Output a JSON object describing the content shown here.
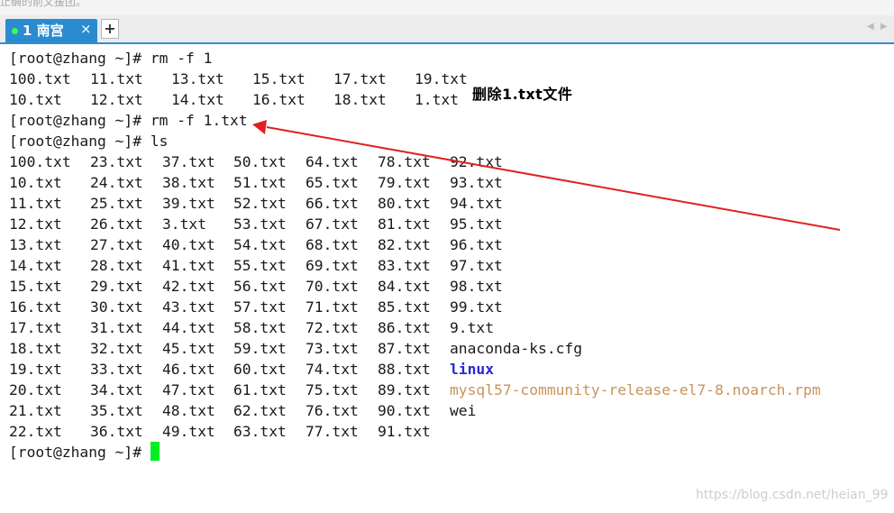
{
  "window": {
    "cut_off_text": "止确的前文援团。",
    "tab": {
      "label": "1 南宫",
      "close": "×"
    },
    "new_tab": "+",
    "nav_left": "◀",
    "nav_right": "▶"
  },
  "terminal": {
    "lines": [
      "[root@zhang ~]# rm -f 1",
      [
        "100.txt",
        "11.txt",
        "13.txt",
        "15.txt",
        "17.txt",
        "19.txt"
      ],
      [
        "10.txt",
        "12.txt",
        "14.txt",
        "16.txt",
        "18.txt",
        "1.txt"
      ],
      "[root@zhang ~]# rm -f 1.txt",
      "[root@zhang ~]# ls",
      [
        "100.txt",
        "23.txt",
        "37.txt",
        "50.txt",
        "64.txt",
        "78.txt",
        "92.txt"
      ],
      [
        "10.txt",
        "24.txt",
        "38.txt",
        "51.txt",
        "65.txt",
        "79.txt",
        "93.txt"
      ],
      [
        "11.txt",
        "25.txt",
        "39.txt",
        "52.txt",
        "66.txt",
        "80.txt",
        "94.txt"
      ],
      [
        "12.txt",
        "26.txt",
        "3.txt",
        "53.txt",
        "67.txt",
        "81.txt",
        "95.txt"
      ],
      [
        "13.txt",
        "27.txt",
        "40.txt",
        "54.txt",
        "68.txt",
        "82.txt",
        "96.txt"
      ],
      [
        "14.txt",
        "28.txt",
        "41.txt",
        "55.txt",
        "69.txt",
        "83.txt",
        "97.txt"
      ],
      [
        "15.txt",
        "29.txt",
        "42.txt",
        "56.txt",
        "70.txt",
        "84.txt",
        "98.txt"
      ],
      [
        "16.txt",
        "30.txt",
        "43.txt",
        "57.txt",
        "71.txt",
        "85.txt",
        "99.txt"
      ],
      [
        "17.txt",
        "31.txt",
        "44.txt",
        "58.txt",
        "72.txt",
        "86.txt",
        "9.txt"
      ],
      [
        "18.txt",
        "32.txt",
        "45.txt",
        "59.txt",
        "73.txt",
        "87.txt",
        "anaconda-ks.cfg"
      ],
      [
        "19.txt",
        "33.txt",
        "46.txt",
        "60.txt",
        "74.txt",
        "88.txt",
        "linux"
      ],
      [
        "20.txt",
        "34.txt",
        "47.txt",
        "61.txt",
        "75.txt",
        "89.txt",
        "mysql57-community-release-el7-8.noarch.rpm"
      ],
      [
        "21.txt",
        "35.txt",
        "48.txt",
        "62.txt",
        "76.txt",
        "90.txt",
        "wei"
      ],
      [
        "22.txt",
        "36.txt",
        "49.txt",
        "63.txt",
        "77.txt",
        "91.txt"
      ],
      "[root@zhang ~]# "
    ],
    "directory_entries": [
      "linux"
    ],
    "archive_entries": [
      "mysql57-community-release-el7-8.noarch.rpm"
    ]
  },
  "annotation": {
    "text": "删除1.txt文件",
    "arrow_color": "#e02020"
  },
  "watermark": "https://blog.csdn.net/heian_99",
  "colors": {
    "tab_active": "#2b8bd0",
    "cursor": "#00ee22",
    "directory": "#2727d8",
    "archive": "#c8935a"
  }
}
